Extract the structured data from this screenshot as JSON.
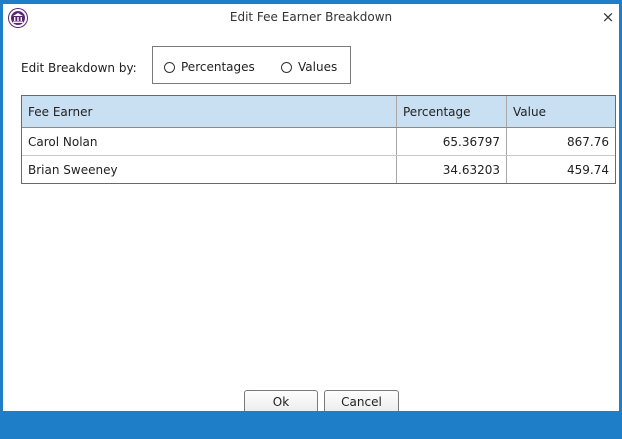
{
  "window": {
    "title": "Edit Fee Earner Breakdown",
    "close_glyph": "×",
    "app_icon": "bank-building-icon",
    "accent_color": "#1e7fc8"
  },
  "breakdown": {
    "label": "Edit Breakdown by:",
    "options": [
      "Percentages",
      "Values"
    ],
    "selected": null
  },
  "table": {
    "columns": [
      "Fee Earner",
      "Percentage",
      "Value"
    ],
    "header_color": "#c9dff2",
    "rows": [
      {
        "fee_earner": "Carol Nolan",
        "percentage": "65.36797",
        "value": "867.76"
      },
      {
        "fee_earner": "Brian Sweeney",
        "percentage": "34.63203",
        "value": "459.74"
      }
    ]
  },
  "buttons": {
    "ok": "Ok",
    "cancel": "Cancel"
  }
}
